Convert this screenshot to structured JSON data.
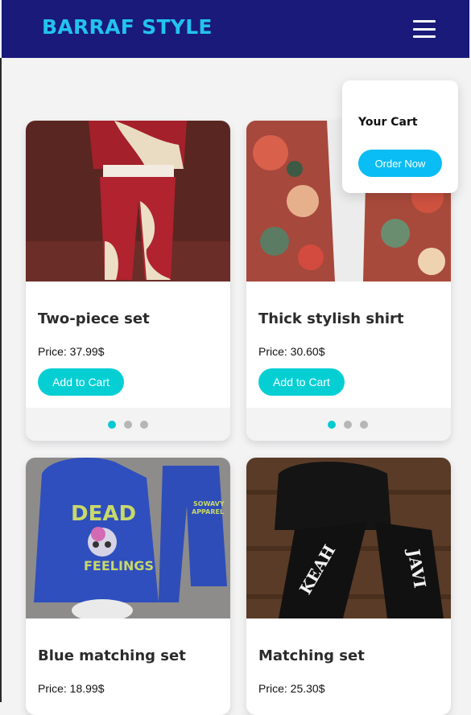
{
  "header": {
    "brand": "BARRAF STYLE",
    "menu_icon": "hamburger-menu-icon"
  },
  "cart": {
    "title": "Your Cart",
    "order_label": "Order Now"
  },
  "products": [
    {
      "title": "Two-piece set",
      "price": "Price: 37.99$",
      "button": "Add to Cart",
      "image": "red-cream-tracksuit",
      "slides": 3,
      "active_slide": 1
    },
    {
      "title": "Thick stylish shirt",
      "price": "Price: 30.60$",
      "button": "Add to Cart",
      "image": "floral-tapestry-jacket",
      "slides": 3,
      "active_slide": 1
    },
    {
      "title": "Blue matching set",
      "price": "Price: 18.99$",
      "image": "blue-skull-graphic-tracksuit"
    },
    {
      "title": "Matching set",
      "price": "Price: 25.30$",
      "image": "black-gothic-letter-tracksuit"
    }
  ],
  "colors": {
    "header_bg": "#191a79",
    "brand": "#22c3ef",
    "accent": "#06cfd4",
    "order_button": "#0abdf4"
  }
}
